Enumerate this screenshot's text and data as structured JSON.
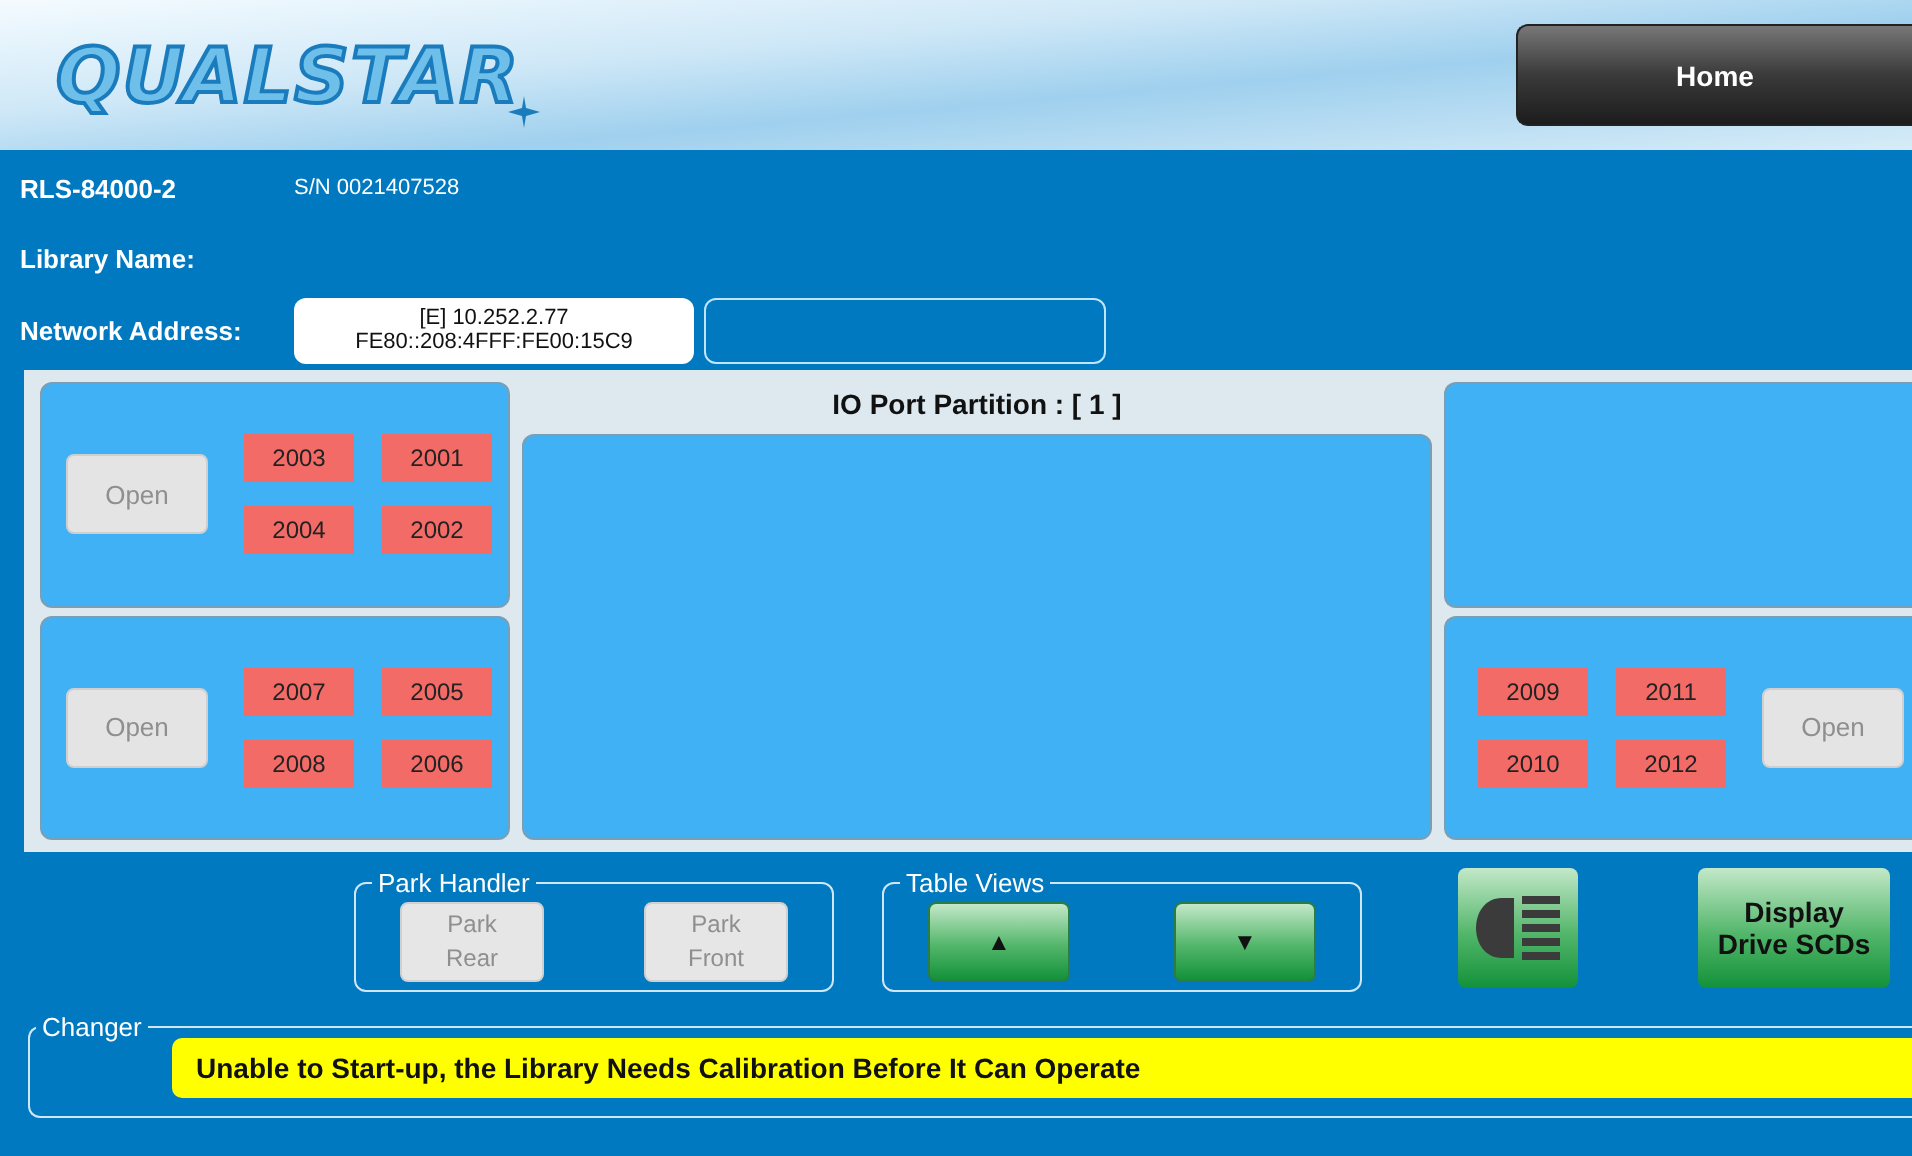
{
  "header": {
    "logo": "QUALSTAR",
    "home_button": "Home"
  },
  "info": {
    "model": "RLS-84000-2",
    "serial": "S/N 0021407528",
    "library_name_label": "Library Name:",
    "network_label": "Network Address:",
    "network_address": [
      "[E] 10.252.2.77",
      "FE80::208:4FFF:FE00:15C9"
    ]
  },
  "left_column": [
    {
      "kind": "magazine",
      "open_button": {
        "label": "Open",
        "disabled": true
      },
      "tiles": [
        "2003",
        "2001",
        "2004",
        "2002"
      ]
    },
    {
      "kind": "magazine",
      "open_button": {
        "label": "Open",
        "disabled": true
      },
      "tiles": [
        "2007",
        "2005",
        "2008",
        "2006"
      ]
    }
  ],
  "io_partition": {
    "title": "IO Port Partition : [ 1 ]"
  },
  "right_column": [
    {
      "kind": "empty"
    },
    {
      "kind": "magazine",
      "open_button": {
        "label": "Open",
        "disabled": true
      },
      "tiles": [
        "2009",
        "2011",
        "2010",
        "2012"
      ]
    }
  ],
  "park_handler": {
    "legend": "Park Handler",
    "buttons": [
      {
        "label": "Park Rear",
        "disabled": true
      },
      {
        "label": "Park Front",
        "disabled": true
      }
    ]
  },
  "table_views": {
    "legend": "Table Views",
    "buttons": [
      {
        "label": "▲",
        "disabled": false
      },
      {
        "label": "▼",
        "disabled": false
      }
    ]
  },
  "display_button": {
    "label": "Display Drive SCDs"
  },
  "changer": {
    "legend": "Changer",
    "message": "Unable to Start-up, the Library Needs Calibration Before It Can Operate"
  }
}
